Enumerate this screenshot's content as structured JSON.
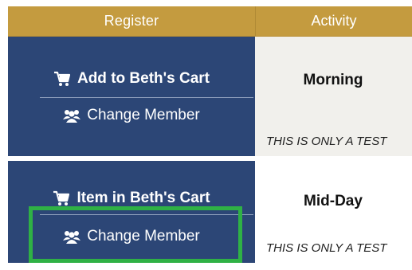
{
  "header": {
    "register": "Register",
    "activity": "Activity"
  },
  "rows": [
    {
      "cart_action": "Add to Beth's Cart",
      "member_action": "Change Member",
      "time": "Morning",
      "note": "THIS IS ONLY A TEST"
    },
    {
      "cart_action": "Item in Beth's Cart",
      "member_action": "Change Member",
      "time": "Mid-Day",
      "note": "THIS IS ONLY A TEST"
    }
  ],
  "colors": {
    "header_gold": "#c49b3f",
    "register_navy": "#2c4676",
    "highlight_green": "#2fb145"
  },
  "icons": {
    "cart": "cart-icon",
    "members": "users-icon"
  }
}
